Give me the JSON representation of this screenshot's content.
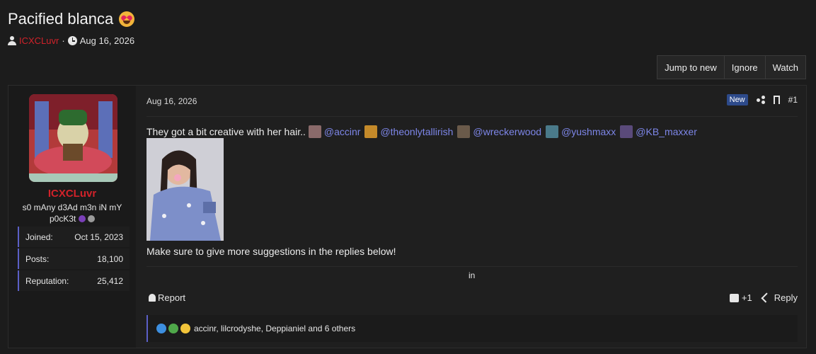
{
  "thread": {
    "title": "Pacified blanca",
    "title_emoji": "heart-eyes-emoji",
    "author": "ICXCLuvr",
    "separator": "·",
    "date": "Aug 16, 2026"
  },
  "thread_actions": {
    "jump_to_new": "Jump to new",
    "ignore": "Ignore",
    "watch": "Watch"
  },
  "post": {
    "user": {
      "name": "ICXCLuvr",
      "title": "s0 mAny d3Ad m3n iN mY p0cK3t",
      "stats": [
        {
          "label": "Joined:",
          "value": "Oct 15, 2023"
        },
        {
          "label": "Posts:",
          "value": "18,100"
        },
        {
          "label": "Reputation:",
          "value": "25,412"
        }
      ]
    },
    "date": "Aug 16, 2026",
    "badge": "New",
    "number": "#1",
    "body_text": "They got a bit creative with her hair..",
    "mentions": [
      "@accinr",
      "@theonlytallirish",
      "@wreckerwood",
      "@yushmaxx",
      "@KB_maxxer"
    ],
    "footer_text": "Make sure to give more suggestions in the replies below!",
    "signature": "in",
    "report": "Report",
    "like_count": "+1",
    "reply": "Reply",
    "reactions_summary": "accinr, lilcrodyshe, Deppianiel and 6 others"
  },
  "colors": {
    "username": "#d1222a",
    "mention": "#7d86e8",
    "accent": "#5b5fc7",
    "badge": "#2d4a8a"
  }
}
